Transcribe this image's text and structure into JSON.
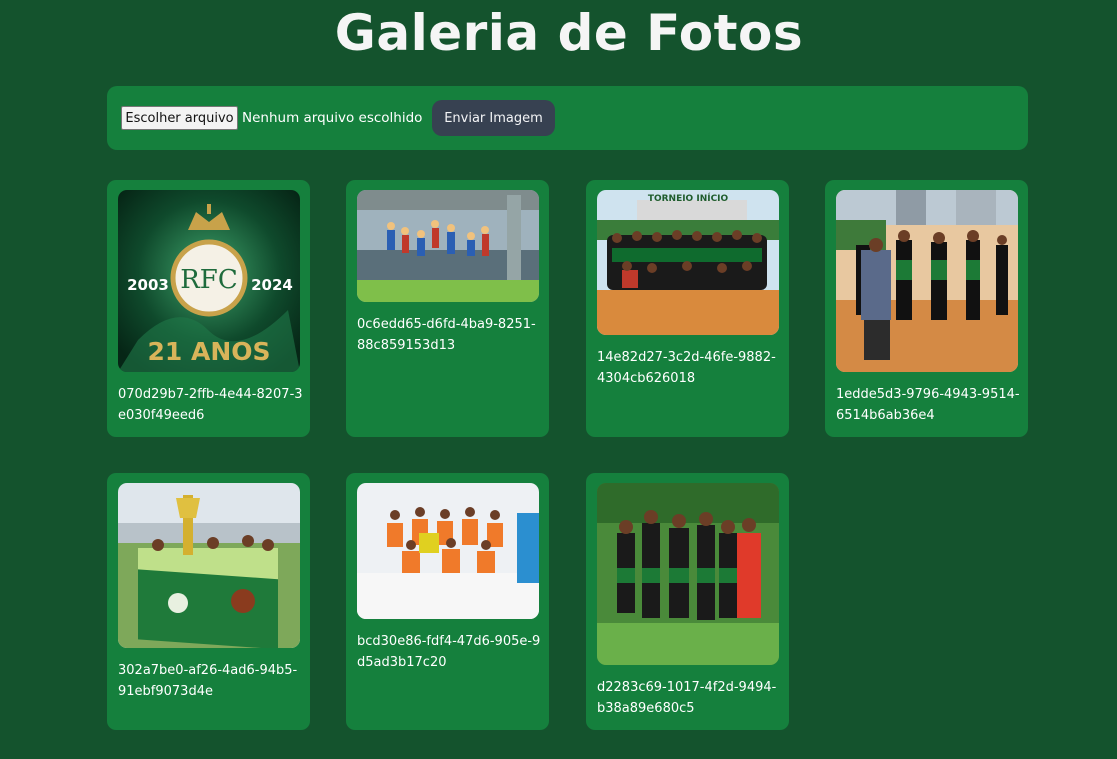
{
  "page": {
    "title": "Galeria de Fotos"
  },
  "upload": {
    "choose_label": "Escolher arquivo",
    "file_status": "Nenhum arquivo escolhido",
    "send_label": "Enviar Imagem"
  },
  "gallery": {
    "items": [
      {
        "caption": "070d29b7-2ffb-4e44-8207-3e030f49eed6",
        "image": "club-21-anos-logo"
      },
      {
        "caption": "0c6edd65-d6fd-4ba9-8251-88c859153d13",
        "image": "fans-in-stands"
      },
      {
        "caption": "14e82d27-3c2d-46fe-9882-4304cb626018",
        "image": "team-group-photo-torneio"
      },
      {
        "caption": "1edde5d3-9796-4943-9514-6514b6ab36e4",
        "image": "players-celebrating"
      },
      {
        "caption": "302a7be0-af26-4ad6-94b5-91ebf9073d4e",
        "image": "trophy-with-flag"
      },
      {
        "caption": "bcd30e86-fdf4-47d6-905e-9d5ad3b17c20",
        "image": "orange-team-indoor"
      },
      {
        "caption": "d2283c69-1017-4f2d-9494-b38a89e680c5",
        "image": "team-huddle-on-pitch"
      }
    ],
    "logo_text": {
      "year_left": "2003",
      "year_right": "2024",
      "banner": "21 ANOS",
      "monogram": "RFC"
    },
    "banner_text": "TORNEIO INÍCIO"
  },
  "colors": {
    "page_bg": "#14532d",
    "card_bg": "#15803d",
    "send_button": "#374151",
    "logo_gold": "#c8a24a"
  }
}
